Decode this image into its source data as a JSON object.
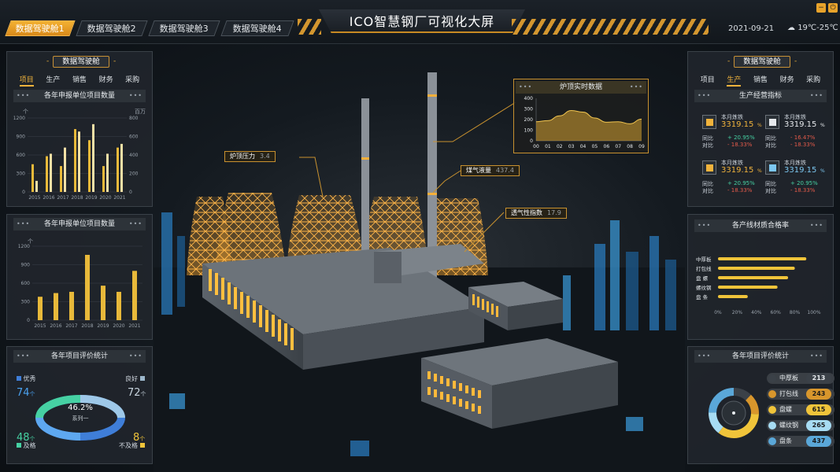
{
  "header": {
    "tabs": [
      {
        "label": "数据驾驶舱1",
        "active": true
      },
      {
        "label": "数据驾驶舱2",
        "active": false
      },
      {
        "label": "数据驾驶舱3",
        "active": false
      },
      {
        "label": "数据驾驶舱4",
        "active": false
      }
    ],
    "title": "ICO智慧钢厂可视化大屏",
    "date": "2021-09-21",
    "weather": "19℃-25℃",
    "weather_icon": "cloud-rain-icon",
    "controls": [
      "minimize-icon",
      "power-icon"
    ],
    "accent": "#f0a92e"
  },
  "left_top": {
    "pill": "数据驾驶舱",
    "tabs": [
      "项目",
      "生产",
      "销售",
      "财务",
      "采购"
    ],
    "active_tab": "项目",
    "chart_title": "各年申报单位项目数量",
    "left_unit": "个",
    "right_unit": "百万",
    "chart_data": {
      "type": "bar",
      "categories": [
        "2015",
        "2016",
        "2017",
        "2018",
        "2019",
        "2020",
        "2021"
      ],
      "series": [
        {
          "values": [
            450,
            580,
            420,
            1020,
            840,
            420,
            720
          ],
          "color": "#e8b93a"
        },
        {
          "values": [
            180,
            620,
            720,
            980,
            1100,
            620,
            780
          ],
          "color": "#f3e0a6"
        }
      ],
      "ylim": [
        0,
        1200
      ],
      "yticks": [
        "0",
        "300",
        "600",
        "900",
        "1200"
      ],
      "y2ticks": [
        "0",
        "200",
        "400",
        "600",
        "800"
      ]
    }
  },
  "left_mid": {
    "chart_title": "各年申报单位项目数量",
    "unit": "个",
    "chart_data": {
      "type": "bar",
      "categories": [
        "2015",
        "2016",
        "2017",
        "2018",
        "2019",
        "2020",
        "2021"
      ],
      "values": [
        380,
        440,
        460,
        1060,
        560,
        460,
        800
      ],
      "ylim": [
        0,
        1200
      ],
      "yticks": [
        "0",
        "300",
        "600",
        "900",
        "1200"
      ]
    }
  },
  "left_bottom": {
    "chart_title": "各年项目评价统计",
    "excellent_label": "优秀",
    "excellent_value": "74",
    "excellent_unit": "个",
    "good_label": "良好",
    "good_value": "72",
    "good_unit": "个",
    "pass_label": "及格",
    "pass_value": "48",
    "pass_unit": "个",
    "fail_label": "不及格",
    "fail_value": "8",
    "fail_unit": "个",
    "center_value": "46.2%",
    "center_label": "系列一"
  },
  "scene": {
    "labels": [
      {
        "name": "炉顶压力",
        "value": "3.4"
      },
      {
        "name": "煤气液量",
        "value": "437.4"
      },
      {
        "name": "透气性指数",
        "value": "17.9"
      }
    ],
    "realtime": {
      "title": "炉顶实时数据",
      "chart_data": {
        "type": "area",
        "x": [
          "00",
          "01",
          "02",
          "03",
          "04",
          "05",
          "06",
          "07",
          "08",
          "09"
        ],
        "values": [
          180,
          190,
          235,
          285,
          270,
          215,
          175,
          180,
          160,
          205
        ],
        "ylim": [
          0,
          400
        ],
        "yticks": [
          "0",
          "100",
          "200",
          "300",
          "400"
        ]
      }
    }
  },
  "right_top": {
    "pill": "数据驾驶舱",
    "tabs": [
      "项目",
      "生产",
      "销售",
      "财务",
      "采购"
    ],
    "active_tab": "生产",
    "section_title": "生产经营指标",
    "metrics": [
      {
        "label": "本月炼铁",
        "value": "3319.15",
        "unit": "%",
        "tongbi_label": "同比",
        "tongbi": "+ 20.95%",
        "huanbi_label": "对比",
        "huanbi": "- 18.33%",
        "color": "#f0b33c",
        "icon": "steel-icon"
      },
      {
        "label": "本月炼铁",
        "value": "3319.15",
        "unit": "%",
        "tongbi_label": "同比",
        "tongbi": "- 16.47%",
        "huanbi_label": "对比",
        "huanbi": "- 18.33%",
        "color": "#e6e9ec",
        "icon": "grid-icon"
      },
      {
        "label": "本月炼铁",
        "value": "3319.15",
        "unit": "%",
        "tongbi_label": "同比",
        "tongbi": "+ 20.95%",
        "huanbi_label": "对比",
        "huanbi": "- 18.33%",
        "color": "#f0b33c",
        "icon": "bucket-icon"
      },
      {
        "label": "本月炼铁",
        "value": "3319.15",
        "unit": "%",
        "tongbi_label": "同比",
        "tongbi": "+ 20.95%",
        "huanbi_label": "对比",
        "huanbi": "- 18.33%",
        "color": "#7cc7f0",
        "icon": "truck-icon"
      }
    ]
  },
  "right_mid": {
    "chart_title": "各产线材质合格率",
    "chart_data": {
      "type": "bar",
      "orientation": "horizontal",
      "categories": [
        "中厚板",
        "打包线",
        "盘 螺",
        "螺纹钢",
        "盘 条"
      ],
      "values": [
        92,
        80,
        73,
        62,
        31
      ],
      "ylim": [
        0,
        100
      ],
      "ticks": [
        "0%",
        "20%",
        "40%",
        "60%",
        "80%",
        "100%"
      ]
    }
  },
  "right_bottom": {
    "chart_title": "各年项目评价统计",
    "items": [
      {
        "name": "中厚板",
        "value": "213",
        "color": "#3b4148"
      },
      {
        "name": "打包线",
        "value": "243",
        "color": "#d8962c"
      },
      {
        "name": "盘螺",
        "value": "615",
        "color": "#f0c43a"
      },
      {
        "name": "螺纹钢",
        "value": "265",
        "color": "#a7dcf3"
      },
      {
        "name": "盘条",
        "value": "437",
        "color": "#5aa7d8"
      }
    ]
  }
}
